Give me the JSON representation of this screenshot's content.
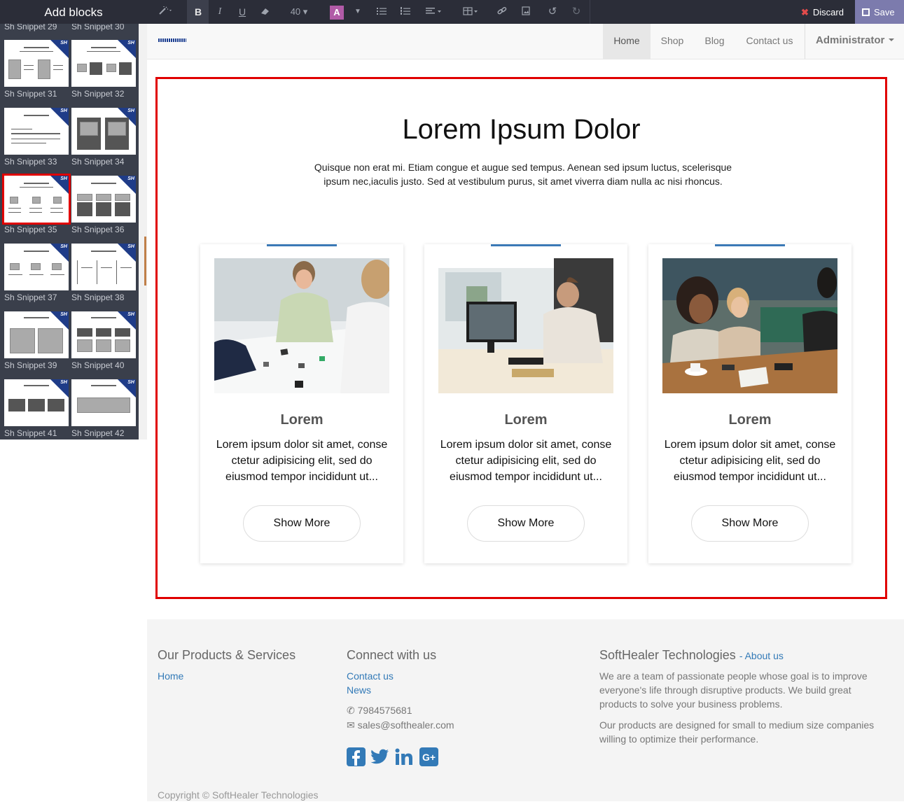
{
  "sidebar": {
    "header": "Add blocks",
    "top_labels": [
      "Sh Snippet 29",
      "Sh Snippet 30"
    ],
    "snippets": [
      {
        "label": "Sh Snippet 31"
      },
      {
        "label": "Sh Snippet 32"
      },
      {
        "label": "Sh Snippet 33"
      },
      {
        "label": "Sh Snippet 34"
      },
      {
        "label": "Sh Snippet 35",
        "selected": true
      },
      {
        "label": "Sh Snippet 36"
      },
      {
        "label": "Sh Snippet 37"
      },
      {
        "label": "Sh Snippet 38"
      },
      {
        "label": "Sh Snippet 39"
      },
      {
        "label": "Sh Snippet 40"
      },
      {
        "label": "Sh Snippet 41"
      },
      {
        "label": "Sh Snippet 42"
      }
    ]
  },
  "toolbar": {
    "bold": "B",
    "italic": "I",
    "underline": "U",
    "font_size": "40",
    "color_btn": "A",
    "discard_label": "Discard",
    "save_label": "Save"
  },
  "nav": {
    "items": [
      "Home",
      "Shop",
      "Blog",
      "Contact us"
    ],
    "active": "Home",
    "user": "Administrator"
  },
  "main": {
    "title": "Lorem Ipsum Dolor",
    "subtitle": "Quisque non erat mi. Etiam congue et augue sed tempus. Aenean sed ipsum luctus, scelerisque ipsum nec,iaculis justo. Sed at vestibulum purus, sit amet viverra diam nulla ac nisi rhoncus.",
    "cards": [
      {
        "heading": "Lorem",
        "text": "Lorem ipsum dolor sit amet, conse ctetur adipisicing elit, sed do eiusmod tempor incididunt ut...",
        "button": "Show More"
      },
      {
        "heading": "Lorem",
        "text": "Lorem ipsum dolor sit amet, conse ctetur adipisicing elit, sed do eiusmod tempor incididunt ut...",
        "button": "Show More"
      },
      {
        "heading": "Lorem",
        "text": "Lorem ipsum dolor sit amet, conse ctetur adipisicing elit, sed do eiusmod tempor incididunt ut...",
        "button": "Show More"
      }
    ]
  },
  "footer": {
    "col1": {
      "heading": "Our Products & Services",
      "links": [
        "Home"
      ]
    },
    "col2": {
      "heading": "Connect with us",
      "links": [
        "Contact us",
        "News"
      ],
      "phone": "7984575681",
      "email": "sales@softhealer.com",
      "social_icons": [
        "facebook-icon",
        "twitter-icon",
        "linkedin-icon",
        "google-plus-icon"
      ]
    },
    "col3": {
      "heading": "SoftHealer Technologies",
      "about_link": "About us",
      "para1": "We are a team of passionate people whose goal is to improve everyone's life through disruptive products. We build great products to solve your business problems.",
      "para2": "Our products are designed for small to medium size companies willing to optimize their performance."
    },
    "copyright": "Copyright © SoftHealer Technologies"
  },
  "colors": {
    "accent_blue": "#337ab7",
    "selection_red": "#e00000",
    "toolbar_bg": "#2b2d38",
    "save_bg": "#7c7bad"
  }
}
